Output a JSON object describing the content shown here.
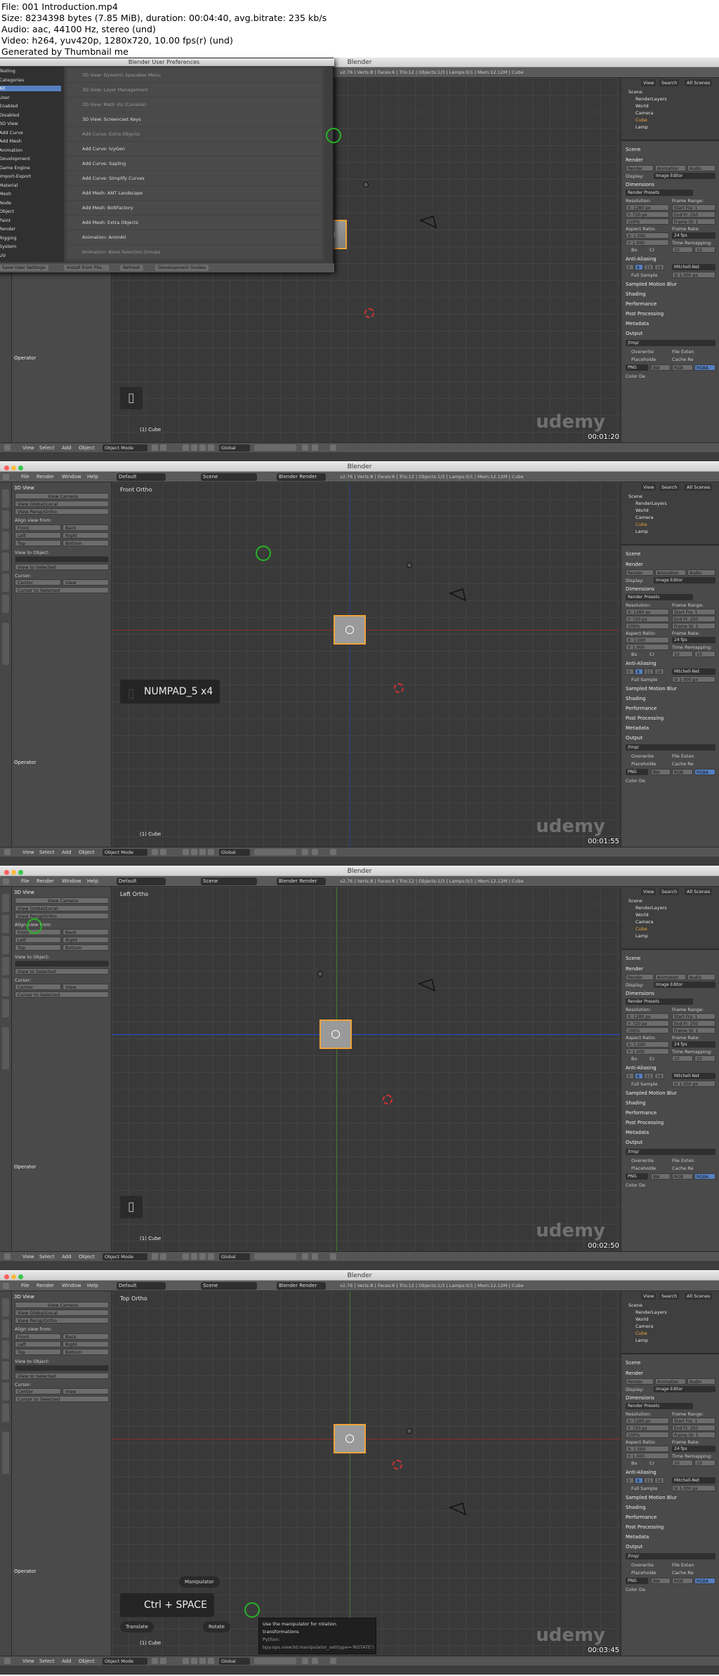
{
  "meta": {
    "line1": "File: 001 Introduction.mp4",
    "line2": "Size: 8234398 bytes (7.85 MiB), duration: 00:04:40, avg.bitrate: 235 kb/s",
    "line3": "Audio: aac, 44100 Hz, stereo (und)",
    "line4": "Video: h264, yuv420p, 1280x720, 10.00 fps(r) (und)",
    "line5": "Generated by Thumbnail me"
  },
  "window": {
    "title": "Blender"
  },
  "menus": [
    "File",
    "Render",
    "Window",
    "Help"
  ],
  "layout": "Default",
  "scene": "Scene",
  "engine": "Blender Render",
  "stats": "v2.76 | Verts:8 | Faces:6 | Tris:12 | Objects:1/3 | Lamps:0/1 | Mem:12.12M | Cube",
  "toolshelf": {
    "panel": "3D View",
    "view_camera": "View Camera",
    "view_global_local": "View Global/Local",
    "view_persp_ortho": "View Persp/Ortho",
    "align_from": "Align view from:",
    "front": "Front",
    "back": "Back",
    "left": "Left",
    "right": "Right",
    "top": "Top",
    "bottom": "Bottom",
    "view_to_object": "View to Object:",
    "view_to_selected": "View to Selected",
    "cursor": "Cursor:",
    "center": "Center",
    "view": "View",
    "cursor_to_selected": "Cursor to Selected",
    "operator": "Operator"
  },
  "header": {
    "view": "View",
    "select": "Select",
    "add": "Add",
    "object": "Object",
    "mode": "Object Mode",
    "orientation": "Global"
  },
  "outliner": {
    "tabs": [
      "View",
      "Search",
      "All Scenes"
    ],
    "items": [
      "Scene",
      "RenderLayers",
      "World",
      "Camera",
      "Cube",
      "Lamp"
    ]
  },
  "properties": {
    "scene": "Scene",
    "render": "Render",
    "render_btns": [
      "Render",
      "Animation",
      "Audio"
    ],
    "display_label": "Display:",
    "display_value": "Image Editor",
    "dimensions": "Dimensions",
    "render_presets": "Render Presets",
    "resolution": "Resolution:",
    "frame_range": "Frame Range:",
    "res_x": "X: 1280 px",
    "res_y": "Y: 720 px",
    "res_pct": "100%",
    "start": "Start Fra: 1",
    "end": "End Fr: 250",
    "step": "Frame St: 1",
    "aspect": "Aspect Ratio:",
    "frame_rate": "Frame Rate:",
    "asp_x": "X: 1.000",
    "asp_y": "Y: 1.000",
    "fps": "24 fps",
    "time_remap": "Time Remapping:",
    "remap_a": "10",
    "remap_b": "10",
    "bo": "Bo",
    "cr": "Cr",
    "anti": "Anti-Aliasing",
    "aa": [
      "5",
      "8",
      "11",
      "16"
    ],
    "filter": "Mitchell-Net",
    "full_sample": "Full Sample",
    "filter_size": "Si 1.000 px",
    "sections": [
      "Sampled Motion Blur",
      "Shading",
      "Performance",
      "Post Processing",
      "Metadata",
      "Output"
    ],
    "tmp": "/tmp/",
    "overwrite": "Overwrite",
    "file_ext": "File Exten",
    "placeholders": "Placeholde",
    "cache": "Cache Re",
    "png": "PNG",
    "bw": "BW",
    "rgb": "RGB",
    "rgba": "RGBA",
    "color_depth": "Color De"
  },
  "frames": [
    {
      "view_label": "",
      "timestamp": "00:01:20",
      "prefs": {
        "title": "Blender User Preferences",
        "categories": [
          "Testing",
          "Categories",
          "All",
          "User",
          "Enabled",
          "Disabled",
          "3D View",
          "Add Curve",
          "Add Mesh",
          "Animation",
          "Development",
          "Game Engine",
          "Import-Export",
          "Material",
          "Mesh",
          "Node",
          "Object",
          "Paint",
          "Render",
          "Rigging",
          "System",
          "UV"
        ],
        "addons": [
          "3D View: Dynamic Spacebar Menu",
          "3D View: Layer Management",
          "3D View: Math Vis (Console)",
          "3D View: Screencast Keys",
          "Add Curve: Extra Objects",
          "Add Curve: IvyGen",
          "Add Curve: Sapling",
          "Add Curve: Simplify Curves",
          "Add Mesh: ANT Landscape",
          "Add Mesh: BoltFactory",
          "Add Mesh: Extra Objects",
          "Animation: AnimAll",
          "Animation: Bone Selection Groups"
        ],
        "footer": [
          "Save User Settings",
          "Install from File...",
          "Refresh",
          "Development Guides"
        ]
      },
      "key": ""
    },
    {
      "view_label": "Front Ortho",
      "timestamp": "00:01:55",
      "key": "NUMPAD_5 x4"
    },
    {
      "view_label": "Left Ortho",
      "timestamp": "00:02:50",
      "key": ""
    },
    {
      "view_label": "Top Ortho",
      "timestamp": "00:03:45",
      "key": "Ctrl + SPACE",
      "manipulator": "Manipulator",
      "translate": "Translate",
      "rotate": "Rotate",
      "tooltip1": "Use the manipulator for rotation transformations",
      "tooltip2": "Python: bpy.ops.view3d.manipulator_set(type='ROTATE')"
    }
  ],
  "object_name": "(1) Cube",
  "watermark": "udemy",
  "colors": {
    "accent": "#f0a33a",
    "x_axis": "#c33333",
    "y_axis": "#3fa52d",
    "z_axis": "#2d4fd0",
    "ring": "#27b324"
  }
}
